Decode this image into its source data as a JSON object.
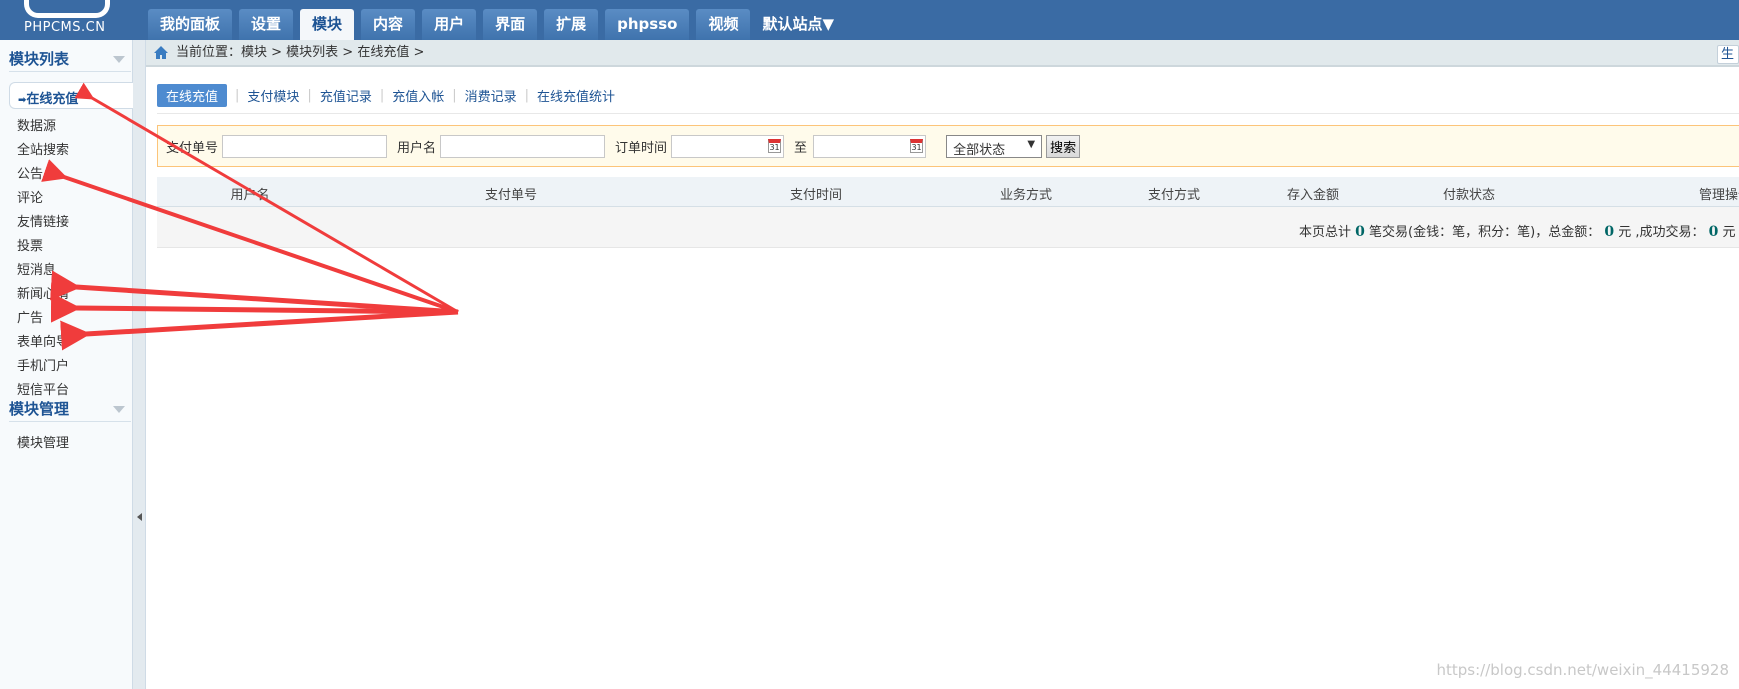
{
  "logo": {
    "text": "PHPCMS.CN"
  },
  "nav": {
    "tabs": [
      "我的面板",
      "设置",
      "模块",
      "内容",
      "用户",
      "界面",
      "扩展",
      "phpsso",
      "视频"
    ],
    "active": "模块",
    "site": "默认站点"
  },
  "sidebar": {
    "section1": "模块列表",
    "items": [
      "在线充值",
      "数据源",
      "全站搜索",
      "公告",
      "评论",
      "友情链接",
      "投票",
      "短消息",
      "新闻心情",
      "广告",
      "表单向导",
      "手机门户",
      "短信平台"
    ],
    "section2": "模块管理",
    "items2": [
      "模块管理"
    ]
  },
  "breadcrumb": {
    "text": "当前位置：模块 > 模块列表 > 在线充值 >",
    "button": "生成"
  },
  "subtabs": [
    "在线充值",
    "支付模块",
    "充值记录",
    "充值入帐",
    "消费记录",
    "在线充值统计"
  ],
  "search": {
    "order_label": "支付单号",
    "order_value": "",
    "user_label": "用户名",
    "user_value": "",
    "time_label": "订单时间",
    "start_value": "",
    "to_label": "至",
    "end_value": "",
    "status": "全部状态",
    "button": "搜索"
  },
  "table": {
    "headers": [
      "用户名",
      "支付单号",
      "支付时间",
      "业务方式",
      "支付方式",
      "存入金额",
      "付款状态",
      "管理操作"
    ],
    "rows": []
  },
  "summary": {
    "p1": "本页总计",
    "count": "0",
    "p2": "笔交易(金钱：笔，积分：笔)，总金额：",
    "total": "0",
    "p3": "元 ,成功交易：",
    "success": "0",
    "p4": "元 ，总点"
  },
  "annotation": {
    "color": "#f03c3c"
  },
  "watermark": "https://blog.csdn.net/weixin_44415928"
}
